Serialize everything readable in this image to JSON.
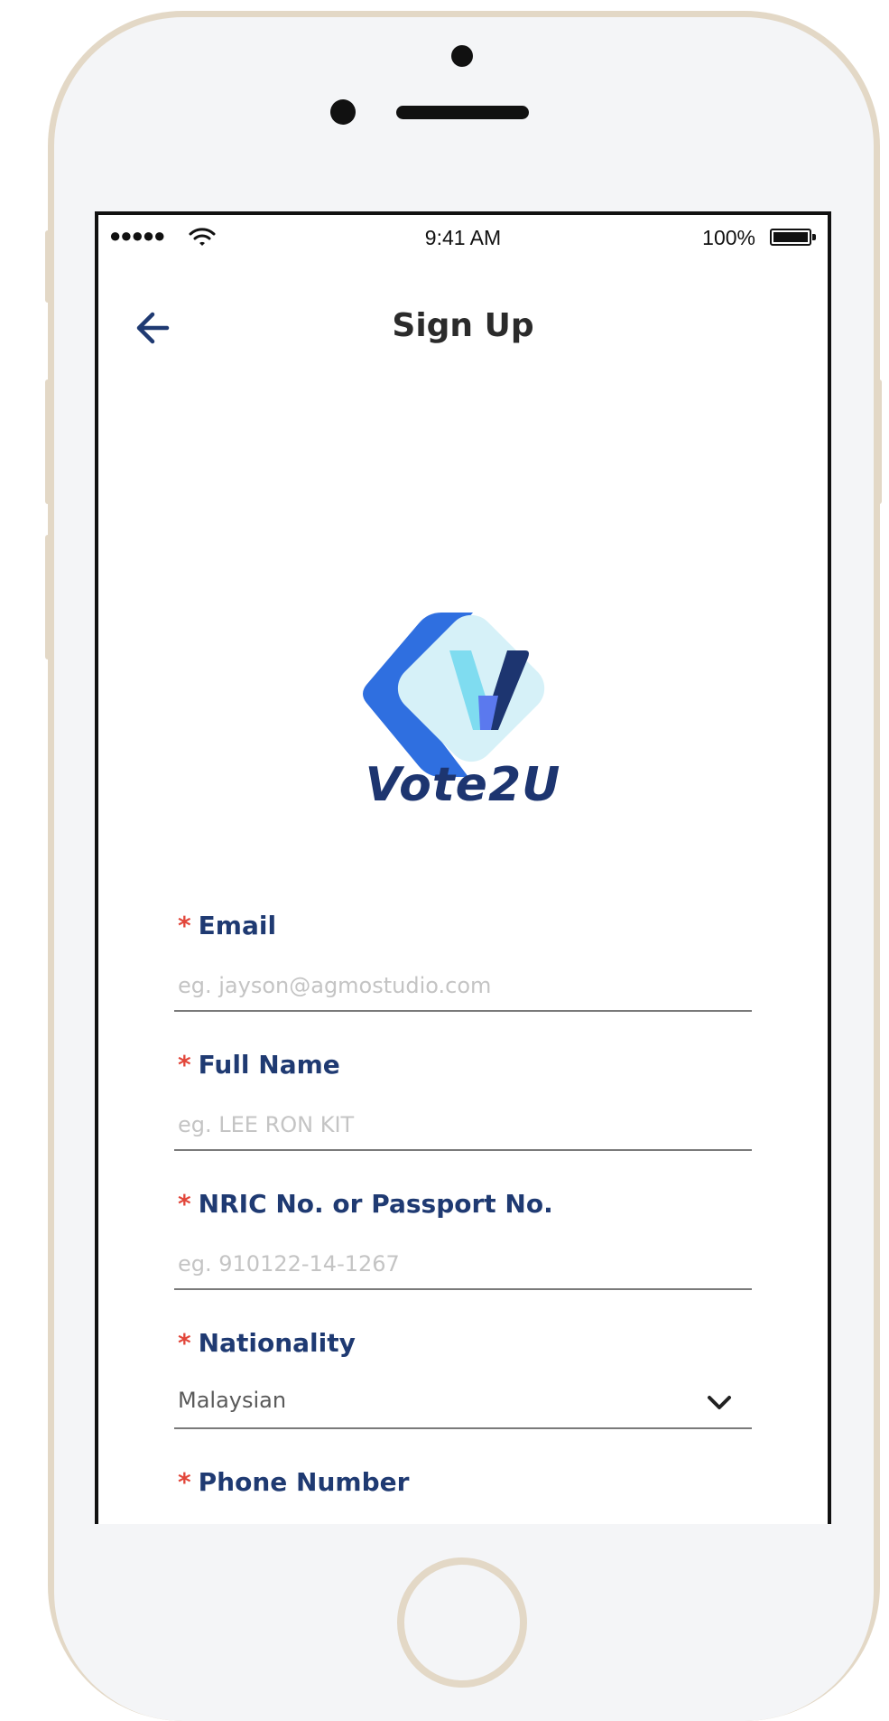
{
  "status_bar": {
    "signal": "●●●●●",
    "time": "9:41 AM",
    "battery": "100%"
  },
  "header": {
    "title": "Sign Up",
    "back_icon": "arrow-left-icon"
  },
  "logo": {
    "wordmark": "Vote2U",
    "colors": {
      "dark_blue": "#1d3570",
      "blue": "#2f6fe0",
      "light_blue": "#7fdcf0",
      "pale": "#d6f1f8"
    }
  },
  "form": {
    "required_marker": "*",
    "email": {
      "label": "Email",
      "placeholder": "eg. jayson@agmostudio.com"
    },
    "full_name": {
      "label": "Full Name",
      "placeholder": "eg. LEE RON KIT"
    },
    "nric": {
      "label": "NRIC No. or Passport No.",
      "placeholder": "eg. 910122-14-1267"
    },
    "nationality": {
      "label": "Nationality",
      "value": "Malaysian",
      "icon": "chevron-down-icon"
    },
    "phone": {
      "label": "Phone Number"
    }
  },
  "colors": {
    "label": "#1f3a72",
    "required": "#e2463a",
    "title": "#2b2b2b",
    "phone_frame": "#e3d8c6"
  }
}
